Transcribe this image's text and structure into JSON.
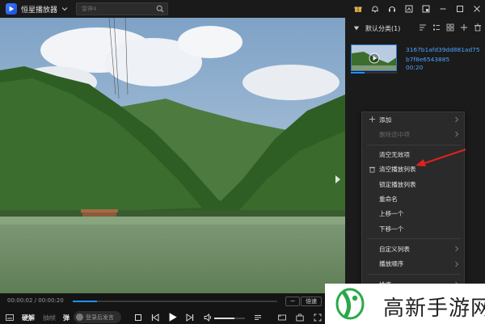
{
  "window": {
    "app_title": "恒星播放器",
    "search_placeholder": "雷神4"
  },
  "titlebar_icons": [
    "gift-icon",
    "bell-icon",
    "headset-icon",
    "screenshot-icon",
    "mini-mode-icon",
    "minimize-icon",
    "maximize-icon",
    "close-icon"
  ],
  "playlist": {
    "title": "默认分类(1)",
    "items": [
      {
        "name": "3167b1afd39dd881ad75b7f8e6543885",
        "duration": "00:20",
        "progress": 0.3
      }
    ]
  },
  "context_menu": {
    "items": [
      {
        "label": "添加",
        "disabled": false,
        "submenu": true
      },
      {
        "label": "删除选中项",
        "disabled": true,
        "submenu": true
      },
      {
        "label": "清空无效项",
        "disabled": false,
        "submenu": false
      },
      {
        "label": "清空播放列表",
        "disabled": false,
        "submenu": false
      },
      {
        "label": "锁定播放列表",
        "disabled": false,
        "submenu": false
      },
      {
        "label": "重命名",
        "disabled": false,
        "submenu": false
      },
      {
        "label": "上移一个",
        "disabled": false,
        "submenu": false
      },
      {
        "label": "下移一个",
        "disabled": false,
        "submenu": false
      },
      {
        "label": "自定义列表",
        "disabled": false,
        "submenu": true
      },
      {
        "label": "播放顺序",
        "disabled": false,
        "submenu": true
      },
      {
        "label": "排序",
        "disabled": false,
        "submenu": true
      }
    ]
  },
  "controls": {
    "time": "00:00:02 / 00:00:20",
    "progress": 0.12,
    "speed_minus": "−",
    "speed_label": "倍速",
    "hwdec_label": "硬解",
    "danmaku_label": "抽帧",
    "dan_label": "弹",
    "danmaku_placeholder": "登录后发言",
    "volume": 0.65
  },
  "watermark": {
    "text": "高新手游网"
  },
  "colors": {
    "accent": "#1e90ff",
    "playlist_text": "#4aa3ff",
    "annotation_arrow": "#e02020"
  }
}
